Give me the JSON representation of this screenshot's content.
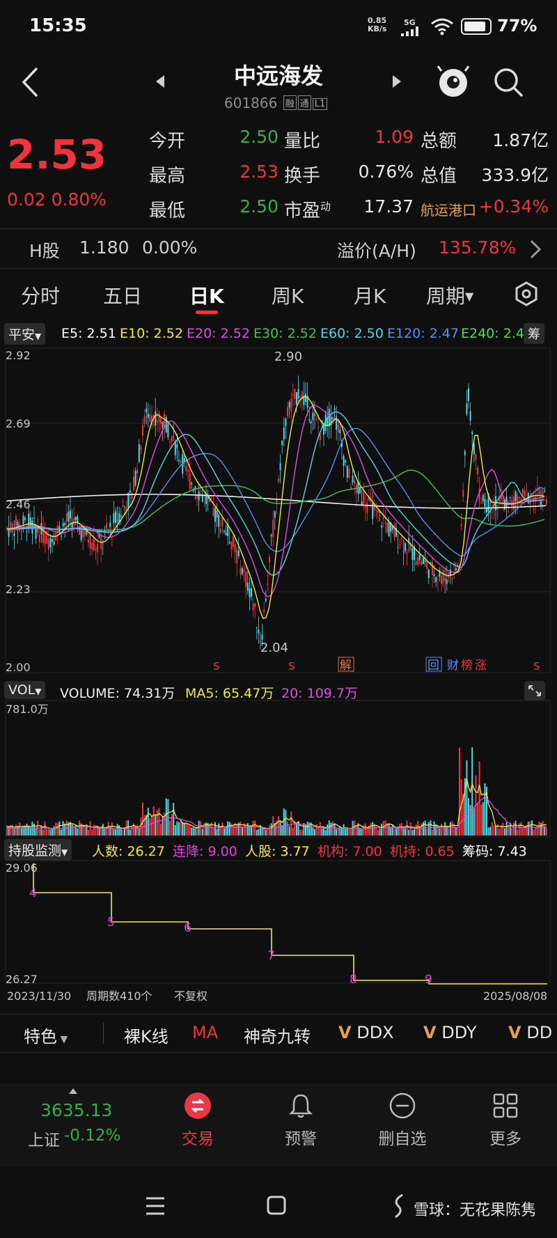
{
  "status_bar": {
    "time": "15:35",
    "net_speed": "0.85\nKB/s",
    "network": "5G",
    "battery": "77%"
  },
  "header": {
    "title": "中远海发",
    "code": "601866",
    "tags": [
      "融",
      "通",
      "L1"
    ]
  },
  "quote": {
    "price": "2.53",
    "change": "0.02",
    "change_pct": "0.80%",
    "rows": [
      [
        {
          "label": "今开",
          "value": "2.50",
          "color": "green"
        },
        {
          "label": "量比",
          "value": "1.09",
          "color": "red"
        },
        {
          "label": "总额",
          "value": "1.87亿",
          "color": "white"
        }
      ],
      [
        {
          "label": "最高",
          "value": "2.53",
          "color": "red"
        },
        {
          "label": "换手",
          "value": "0.76%",
          "color": "white"
        },
        {
          "label": "总值",
          "value": "333.9亿",
          "color": "white"
        }
      ],
      [
        {
          "label": "最低",
          "value": "2.50",
          "color": "green"
        },
        {
          "label": "市盈",
          "value": "17.37",
          "color": "white"
        },
        {
          "label": "航运港口",
          "value": "+0.34%",
          "color": "red"
        }
      ]
    ],
    "pe_superscript": "动"
  },
  "h_share": {
    "label": "H股",
    "price": "1.180",
    "pct": "0.00%",
    "premium_label": "溢价(A/H)",
    "premium": "135.78%"
  },
  "tabs": [
    "分时",
    "五日",
    "日K",
    "周K",
    "月K",
    "周期"
  ],
  "active_tab": 2,
  "ma_legend": {
    "adjust": "平安",
    "items": [
      {
        "label": "E5: 2.51",
        "color": "#ffffff"
      },
      {
        "label": "E10: 2.52",
        "color": "#f2e93a"
      },
      {
        "label": "E20: 2.52",
        "color": "#d94fe0"
      },
      {
        "label": "E30: 2.52",
        "color": "#3fc45a"
      },
      {
        "label": "E60: 2.50",
        "color": "#55d6e6"
      },
      {
        "label": "E120: 2.47",
        "color": "#5a8ef0"
      },
      {
        "label": "E240: 2.4",
        "color": "#45e04a"
      }
    ],
    "chips": "筹"
  },
  "price_axis": [
    "2.92",
    "2.69",
    "2.46",
    "2.23",
    "2.00"
  ],
  "price_marks": {
    "high": "2.90",
    "low": "2.04"
  },
  "event_marks": [
    "S",
    "S",
    "解",
    "回",
    "财",
    "榜",
    "涨",
    "S"
  ],
  "volume": {
    "selector": "VOL",
    "value": "VOLUME: 74.31万",
    "ma5": "MA5: 65.47万",
    "ma20": "20: 109.7万",
    "axis_top": "781.0万"
  },
  "holder": {
    "selector": "持股监测",
    "items": [
      {
        "label": "人数: 26.27",
        "color": "#f2e93a"
      },
      {
        "label": "连降: 9.00",
        "color": "#e03fe0"
      },
      {
        "label": "人股: 3.77",
        "color": "#f2e93a"
      },
      {
        "label": "机构: 7.00",
        "color": "#f1343c"
      },
      {
        "label": "机持: 0.65",
        "color": "#f1343c"
      },
      {
        "label": "筹码: 7.43",
        "color": "#ffffff"
      }
    ],
    "axis_top": "29.06",
    "axis_bottom": "26.27",
    "step_labels": [
      "4",
      "5",
      "6",
      "7",
      "8",
      "9"
    ]
  },
  "date_axis": {
    "start": "2023/11/30",
    "count": "周期数410个",
    "mode": "不复权",
    "end": "2025/08/08"
  },
  "indicators": [
    "特色",
    "裸K线",
    "MA",
    "神奇九转",
    "DDX",
    "DDY",
    "DD"
  ],
  "bottom_nav": {
    "index_value": "3635.13",
    "index_name": "上证",
    "index_pct": "-0.12%",
    "items": [
      "交易",
      "预警",
      "删自选",
      "更多"
    ]
  },
  "watermark": "雪球：无花果陈隽"
}
